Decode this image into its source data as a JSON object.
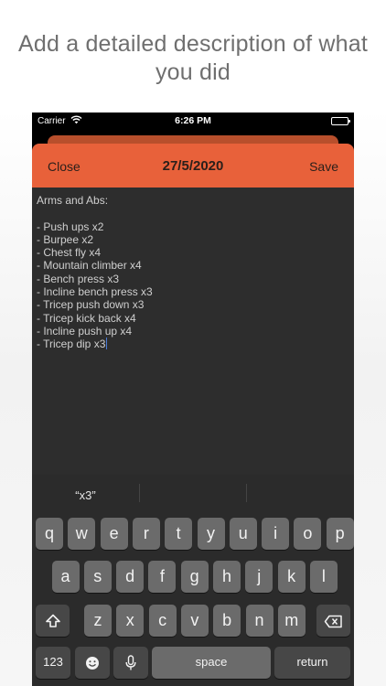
{
  "caption": "Add a detailed description of what you did",
  "status_bar": {
    "carrier": "Carrier",
    "time": "6:26 PM"
  },
  "navbar": {
    "close_label": "Close",
    "title": "27/5/2020",
    "save_label": "Save"
  },
  "note_lines": [
    "Arms and Abs:",
    "",
    "- Push ups x2",
    "- Burpee x2",
    "- Chest fly x4",
    "- Mountain climber x4",
    "- Bench press x3",
    "- Incline bench press x3",
    "- Tricep push down x3",
    "- Tricep kick back x4",
    "- Incline push up x4",
    "- Tricep dip x3"
  ],
  "keyboard": {
    "suggestions": [
      "“x3”",
      "",
      ""
    ],
    "row1": [
      "q",
      "w",
      "e",
      "r",
      "t",
      "y",
      "u",
      "i",
      "o",
      "p"
    ],
    "row2": [
      "a",
      "s",
      "d",
      "f",
      "g",
      "h",
      "j",
      "k",
      "l"
    ],
    "row3": [
      "z",
      "x",
      "c",
      "v",
      "b",
      "n",
      "m"
    ],
    "numbers_label": "123",
    "space_label": "space",
    "return_label": "return"
  },
  "colors": {
    "accent": "#e8613a",
    "sheet": "#2d2d2d",
    "keyboard": "#2b2b2b"
  }
}
